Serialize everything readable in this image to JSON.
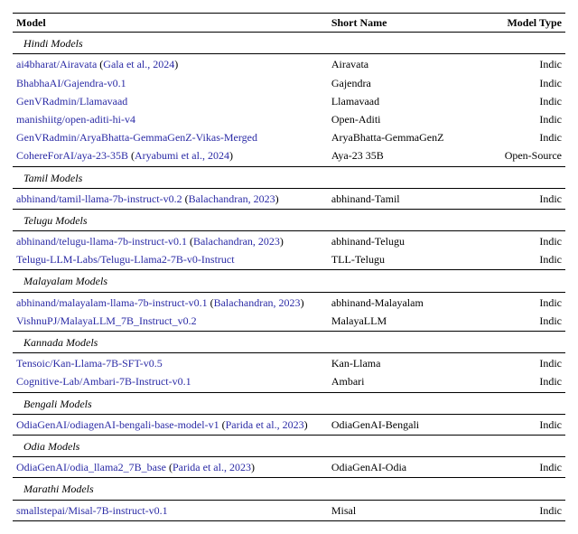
{
  "headers": {
    "model": "Model",
    "short": "Short Name",
    "type": "Model Type"
  },
  "sections": [
    {
      "title": "Hindi Models",
      "rows": [
        {
          "model": "ai4bharat/Airavata",
          "cite": "Gala et al., 2024",
          "short": "Airavata",
          "type": "Indic"
        },
        {
          "model": "BhabhaAI/Gajendra-v0.1",
          "cite": "",
          "short": "Gajendra",
          "type": "Indic"
        },
        {
          "model": "GenVRadmin/Llamavaad",
          "cite": "",
          "short": "Llamavaad",
          "type": "Indic"
        },
        {
          "model": "manishiitg/open-aditi-hi-v4",
          "cite": "",
          "short": "Open-Aditi",
          "type": "Indic"
        },
        {
          "model": "GenVRadmin/AryaBhatta-GemmaGenZ-Vikas-Merged",
          "cite": "",
          "short": "AryaBhatta-GemmaGenZ",
          "type": "Indic"
        },
        {
          "model": "CohereForAI/aya-23-35B",
          "cite": "Aryabumi et al., 2024",
          "short": "Aya-23 35B",
          "type": "Open-Source"
        }
      ]
    },
    {
      "title": "Tamil Models",
      "rows": [
        {
          "model": "abhinand/tamil-llama-7b-instruct-v0.2",
          "cite": "Balachandran, 2023",
          "short": "abhinand-Tamil",
          "type": "Indic"
        }
      ]
    },
    {
      "title": "Telugu Models",
      "rows": [
        {
          "model": "abhinand/telugu-llama-7b-instruct-v0.1",
          "cite": "Balachandran, 2023",
          "short": "abhinand-Telugu",
          "type": "Indic"
        },
        {
          "model": "Telugu-LLM-Labs/Telugu-Llama2-7B-v0-Instruct",
          "cite": "",
          "short": "TLL-Telugu",
          "type": "Indic"
        }
      ]
    },
    {
      "title": "Malayalam Models",
      "rows": [
        {
          "model": "abhinand/malayalam-llama-7b-instruct-v0.1",
          "cite": "Balachandran, 2023",
          "short": "abhinand-Malayalam",
          "type": "Indic"
        },
        {
          "model": "VishnuPJ/MalayaLLM_7B_Instruct_v0.2",
          "cite": "",
          "short": "MalayaLLM",
          "type": "Indic"
        }
      ]
    },
    {
      "title": "Kannada Models",
      "rows": [
        {
          "model": "Tensoic/Kan-Llama-7B-SFT-v0.5",
          "cite": "",
          "short": "Kan-Llama",
          "type": "Indic"
        },
        {
          "model": "Cognitive-Lab/Ambari-7B-Instruct-v0.1",
          "cite": "",
          "short": "Ambari",
          "type": "Indic"
        }
      ]
    },
    {
      "title": "Bengali Models",
      "rows": [
        {
          "model": "OdiaGenAI/odiagenAI-bengali-base-model-v1",
          "cite": "Parida et al., 2023",
          "short": "OdiaGenAI-Bengali",
          "type": "Indic"
        }
      ]
    },
    {
      "title": "Odia Models",
      "rows": [
        {
          "model": "OdiaGenAI/odia_llama2_7B_base",
          "cite": "Parida et al., 2023",
          "short": "OdiaGenAI-Odia",
          "type": "Indic"
        }
      ]
    },
    {
      "title": "Marathi Models",
      "rows": [
        {
          "model": "smallstepai/Misal-7B-instruct-v0.1",
          "cite": "",
          "short": "Misal",
          "type": "Indic"
        }
      ]
    }
  ]
}
